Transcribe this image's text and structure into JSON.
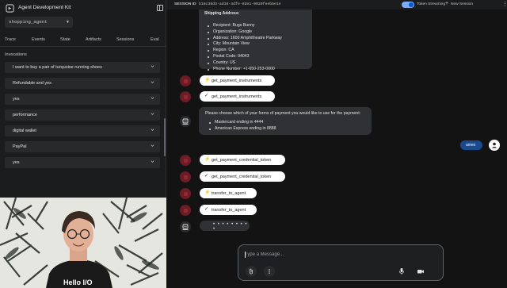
{
  "app": {
    "title": "Agent Development Kit",
    "agent": "shopping_agent",
    "tabs": [
      "Trace",
      "Events",
      "State",
      "Artifacts",
      "Sessions",
      "Eval"
    ],
    "invocations_label": "Invocations",
    "invocations": [
      "I want to buy a pair of turquoise running shoes",
      "Refundable and yes",
      "yes",
      "performance",
      "digital wallet",
      "PayPal",
      "yes"
    ]
  },
  "topbar": {
    "session_label": "SESSION ID",
    "session_id": "b18c38d3-ad16-4dfe-8de1-0020feeb5e1e",
    "streaming_label": "Token Streaming",
    "streaming_on": true,
    "new_session_label": "New Session"
  },
  "chat": {
    "shipping_title": "Shipping Address:",
    "shipping_lines": [
      "Recipient: Bugs Bunny",
      "Organization: Google",
      "Address: 1600 Amphitheatre Parkway",
      "City: Mountain View",
      "Region: CA",
      "Postal Code: 94043",
      "Country: US",
      "Phone Number: +1-650-253-0000"
    ],
    "events": [
      {
        "kind": "call",
        "icon": "⚡",
        "label": "get_payment_instruments"
      },
      {
        "kind": "result",
        "icon": "✓",
        "label": "get_payment_instruments"
      },
      {
        "kind": "call",
        "icon": "⚡",
        "label": "get_payment_credential_token"
      },
      {
        "kind": "result",
        "icon": "✓",
        "label": "get_payment_credential_token"
      },
      {
        "kind": "call",
        "icon": "⚡",
        "label": "transfer_to_agent"
      },
      {
        "kind": "result",
        "icon": "✓",
        "label": "transfer_to_agent"
      }
    ],
    "payment_prompt": "Please choose which of your forms of payment you would like to use for the payment:",
    "payment_options": [
      "Mastercard ending in 4444",
      "American Express ending in 8888"
    ],
    "user_message": "amex",
    "loading": "• • • • • • • • •"
  },
  "input": {
    "placeholder": "Type a Message..."
  }
}
